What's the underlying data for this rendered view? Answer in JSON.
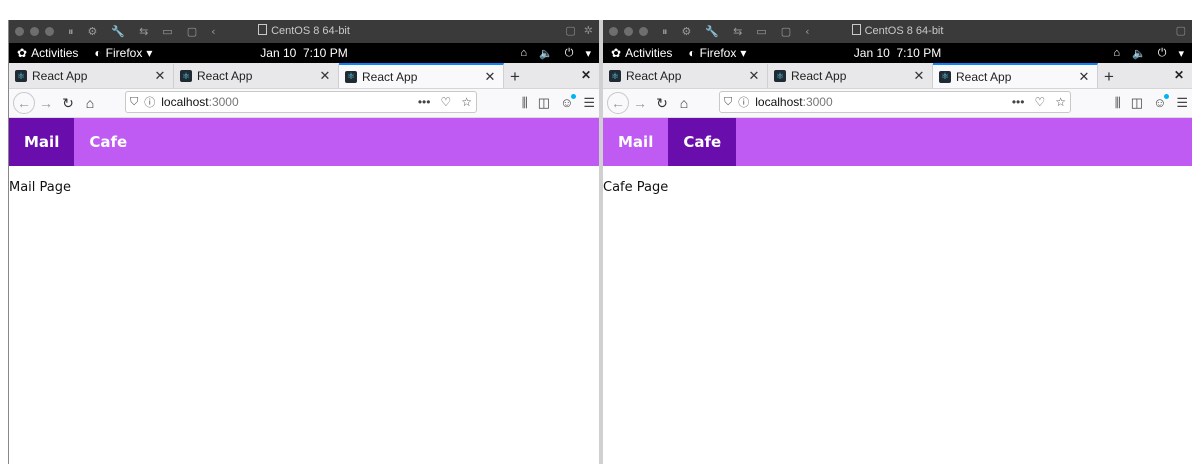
{
  "vm": {
    "title": "CentOS 8 64-bit"
  },
  "gnome": {
    "activities": "Activities",
    "app": "Firefox",
    "date": "Jan 10",
    "time": "7:10 PM"
  },
  "tabs": [
    {
      "label": "React App",
      "favicon": "react-icon"
    },
    {
      "label": "React App",
      "favicon": "react-icon"
    },
    {
      "label": "React App",
      "favicon": "react-icon"
    }
  ],
  "url": {
    "host": "localhost",
    "port": ":3000"
  },
  "windows": [
    {
      "nav": [
        {
          "label": "Mail",
          "active": true
        },
        {
          "label": "Cafe",
          "active": false
        }
      ],
      "content": "Mail Page"
    },
    {
      "nav": [
        {
          "label": "Mail",
          "active": false
        },
        {
          "label": "Cafe",
          "active": true
        }
      ],
      "content": "Cafe Page"
    }
  ],
  "colors": {
    "app_nav": "#bf5af2",
    "app_nav_active": "#6a0dad",
    "tab_accent": "#0a84ff"
  }
}
